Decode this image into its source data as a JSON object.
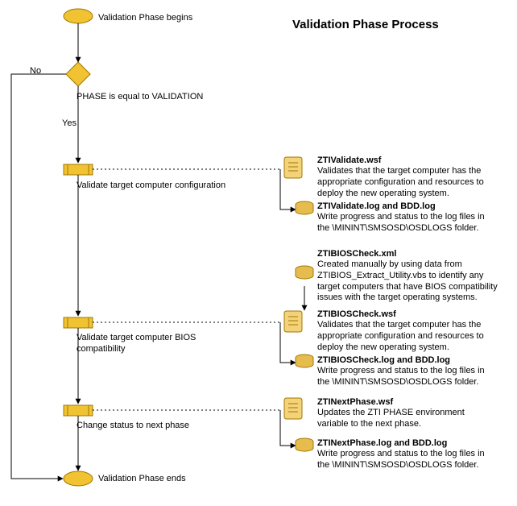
{
  "title": "Validation Phase Process",
  "flow": {
    "start": "Validation Phase begins",
    "decision": "PHASE is equal to VALIDATION",
    "no": "No",
    "yes": "Yes",
    "end": "Validation Phase ends",
    "steps": [
      {
        "label": "Validate target computer configuration"
      },
      {
        "label": "Validate target computer BIOS compatibility"
      },
      {
        "label": "Change status to next phase"
      }
    ]
  },
  "notes": {
    "a1": {
      "title": "ZTIValidate.wsf",
      "body": "Validates that the target computer has the appropriate configuration and resources to deploy the new operating system."
    },
    "a2": {
      "title": "ZTIValidate.log and BDD.log",
      "body": "Write progress and status to the log files in the \\MININT\\SMSOSD\\OSDLOGS folder."
    },
    "b0": {
      "title": "ZTIBIOSCheck.xml",
      "body": "Created manually by using data from ZTIBIOS_Extract_Utility.vbs to identify any target computers that have BIOS compatibility issues with the target operating systems."
    },
    "b1": {
      "title": "ZTIBIOSCheck.wsf",
      "body": "Validates that the target computer has the appropriate configuration and resources to deploy the new operating system."
    },
    "b2": {
      "title": "ZTIBIOSCheck.log and BDD.log",
      "body": "Write progress and status to the log files in the \\MININT\\SMSOSD\\OSDLOGS folder."
    },
    "c1": {
      "title": "ZTINextPhase.wsf",
      "body": "Updates the ZTI PHASE environment variable to the next phase."
    },
    "c2": {
      "title": "ZTINextPhase.log and BDD.log",
      "body": "Write progress and status to the log files in the \\MININT\\SMSOSD\\OSDLOGS folder."
    }
  }
}
